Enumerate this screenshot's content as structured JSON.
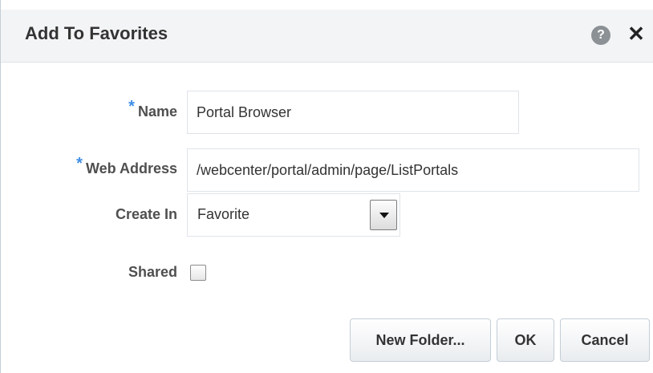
{
  "dialog": {
    "title": "Add To Favorites",
    "help_icon": "question-icon",
    "close_icon": "close-icon",
    "help_glyph": "?",
    "close_glyph": "✕"
  },
  "form": {
    "required_marker": "*",
    "name": {
      "label": "Name",
      "value": "Portal Browser",
      "required": true
    },
    "web_address": {
      "label": "Web Address",
      "value": "/webcenter/portal/admin/page/ListPortals",
      "required": true
    },
    "create_in": {
      "label": "Create In",
      "selected": "Favorite"
    },
    "shared": {
      "label": "Shared",
      "checked": false
    }
  },
  "buttons": {
    "new_folder": "New Folder...",
    "ok": "OK",
    "cancel": "Cancel"
  },
  "colors": {
    "required_marker": "#3e8ee8",
    "header_background": "#f3f4f5"
  }
}
